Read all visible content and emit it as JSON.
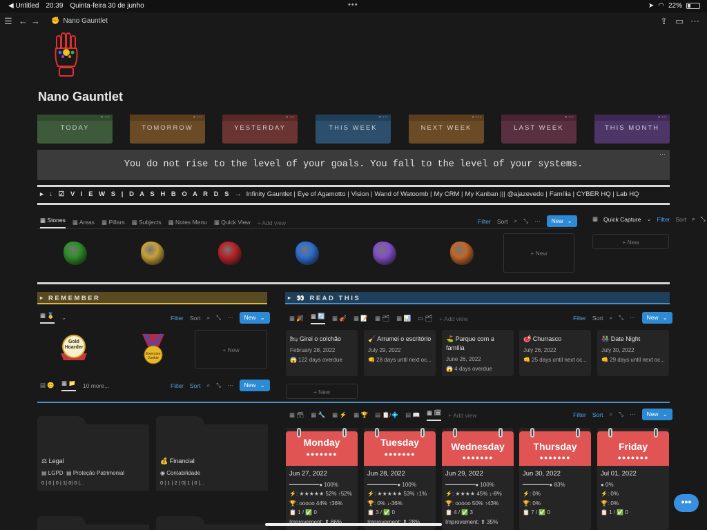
{
  "status_bar": {
    "back_app": "◀ Untitled",
    "time": "20:39",
    "date": "Quinta-feira 30 de junho",
    "battery": "22%",
    "battery_level": 0.22
  },
  "topbar": {
    "page_name": "Nano Gauntlet"
  },
  "page": {
    "title": "Nano Gauntlet"
  },
  "dashboards": [
    {
      "label": "TODAY",
      "color": "#3d5a3b",
      "tab": "#2f4a2d"
    },
    {
      "label": "TOMORROW",
      "color": "#6b4a26",
      "tab": "#5a3d1e"
    },
    {
      "label": "YESTERDAY",
      "color": "#6a3432",
      "tab": "#582826"
    },
    {
      "label": "THIS WEEK",
      "color": "#2b4f6c",
      "tab": "#213f58"
    },
    {
      "label": "NEXT WEEK",
      "color": "#6b4a26",
      "tab": "#5a3d1e"
    },
    {
      "label": "LAST WEEK",
      "color": "#5a2f3f",
      "tab": "#4a2433"
    },
    {
      "label": "THIS MONTH",
      "color": "#4e3568",
      "tab": "#3e2955"
    }
  ],
  "quote": "You do not rise to the level of your goals. You fall to the level of your systems.",
  "views_bar": {
    "prefix": "▸ ↓ ☑ V I E W S | D A S H B O A R D S →",
    "links": [
      "Infinity Gauntlet |",
      "Eye of Agamotto |",
      "Vision |",
      "Wand of Watoomb |",
      "My CRM |",
      "My Kanban |||",
      "@ajazevedo |",
      "Família |",
      "CYBER HQ |",
      "Lab HQ"
    ]
  },
  "stones": {
    "tabs": [
      "Stones",
      "Areas",
      "Pillars",
      "Subjects",
      "Notes Menu",
      "Quick View",
      "+ Add view"
    ],
    "filter": "Filter",
    "sort": "Sort",
    "new": "New",
    "gems": [
      "#2f8f2a",
      "#c9a13c",
      "#b8242a",
      "#2f6fd1",
      "#8450c8",
      "#c2672a"
    ],
    "new_card": "+ New"
  },
  "quick_capture": {
    "title": "Quick Capture",
    "filter": "Filter",
    "sort": "Sort",
    "new_card": "+ New"
  },
  "remember": {
    "title": "REMEMBER",
    "filter": "Filter",
    "sort": "Sort",
    "new": "New",
    "badges": [
      "Gold Hoarder",
      "Exercise Junkie"
    ],
    "new_card": "+ New",
    "tabs2": [
      "10 more..."
    ],
    "filter2": "Filter",
    "sort2": "Sort",
    "new2": "New"
  },
  "folders": [
    {
      "title": "Legal",
      "items": [
        "LGPD",
        "Proteção Patrimonial"
      ],
      "meta": "0 | 0 | 0 | 1| 0| 0 |..."
    },
    {
      "title": "Financial",
      "items": [
        "Contabilidade"
      ],
      "meta": "0 | 1 | 2 | 0| 1 | 0 |..."
    }
  ],
  "read_this": {
    "title": "👀  READ THIS",
    "add_view": "+ Add view",
    "filter": "Filter",
    "sort": "Sort",
    "new": "New",
    "cards": [
      {
        "title": "🛏 Girei o colchão",
        "date": "February 28, 2022",
        "status": "😱 122 days overdue"
      },
      {
        "title": "🧹 Arrumei o escritório",
        "date": "July 29, 2022",
        "status": "👊 28 days until next oc..."
      },
      {
        "title": "⛳ Parque com a família",
        "date": "June 26, 2022",
        "status": "😱 4 days overdue"
      },
      {
        "title": "🥩 Churrasco",
        "date": "July 26, 2022",
        "status": "👊 25 days until next oc..."
      },
      {
        "title": "👫 Date Night",
        "date": "July 30, 2022",
        "status": "👊 29 days until next oc..."
      }
    ],
    "new_card": "+ New"
  },
  "week": {
    "add_view": "+ Add view",
    "filter": "Filter",
    "sort": "Sort",
    "new": "New",
    "days": [
      {
        "name": "Monday",
        "dots": "●●●●●●●",
        "date": "Jun 27, 2022",
        "progress": "━━━━━━━━━● 100%",
        "r1": "⚡: ★★★★★ 52% ↑52%",
        "r2": "🏆: ooooo 44% ↑36%",
        "r3": "📋 1 / ✅ 0",
        "r4": "Improvement: ⬆ 86%"
      },
      {
        "name": "Tuesday",
        "dots": "●●●●●●●",
        "date": "Jun 28, 2022",
        "progress": "━━━━━━━━━● 100%",
        "r1": "⚡: ★★★★★ 53% ↑1%",
        "r2": "🏆: 0% ↓-36%",
        "r3": "📋 3 / ✅ 0",
        "r4": "Improvement: ⬆ 28%"
      },
      {
        "name": "Wednesday",
        "dots": "●●●●●●●",
        "date": "Jun 29, 2022",
        "progress": "━━━━━━━━━● 100%",
        "r1": "⚡: ★★★★ 45% ↓-8%",
        "r2": "🏆: ooooo 50% ↑43%",
        "r3": "📋 4 / ✅ 3",
        "r4": "Improvement: ⬆ 35%"
      },
      {
        "name": "Thursday",
        "dots": "●●●●●●●",
        "date": "Jun 30, 2022",
        "progress": "━━━━━━━━● 83%",
        "r1": "⚡: 0%",
        "r2": "🏆: 0%",
        "r3": "📋 7 / ✅ 0",
        "r4": ""
      },
      {
        "name": "Friday",
        "dots": "●●●●●●●",
        "date": "Jul 01, 2022",
        "progress": "● 0%",
        "r1": "⚡: 0%",
        "r2": "🏆: 0%",
        "r3": "📋 1 / ✅ 0",
        "r4": ""
      }
    ]
  },
  "fab": "•••"
}
